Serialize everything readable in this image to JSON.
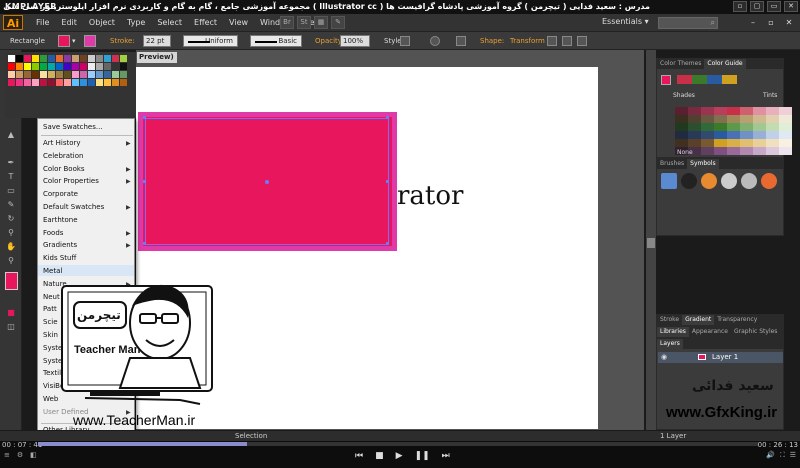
{
  "player": {
    "logo": "KMPLAYER",
    "title": "مجموعه آموزشی جامع ، گام به گام و کاربردی نرم افزار ایلوستریتور سی سی ( Illustrator cc )  مدرس : سعید فدایی ( تیچرمن ) گروه آموزشی پادشاه گرافیست ها",
    "time_elapsed": "00 : 07 : 41",
    "time_total": "00 : 26 : 13",
    "progress_fraction": 0.29,
    "win_controls": [
      "▫",
      "▢",
      "▭",
      "✕"
    ]
  },
  "menu": {
    "logo": "Ai",
    "items": [
      "File",
      "Edit",
      "Object",
      "Type",
      "Select",
      "Effect",
      "View",
      "Window",
      "Help"
    ],
    "workspace": "Essentials ▾"
  },
  "control_bar": {
    "tool_name": "Rectangle",
    "stroke_label": "Stroke:",
    "stroke_weight": "22 pt",
    "profile_label": "Uniform",
    "brush_label": "Basic",
    "opacity_label": "Opacity:",
    "opacity_value": "100%",
    "style_label": "Style:",
    "shape_label": "Shape:",
    "transform_label": "Transform",
    "fill_color": "#e8175d",
    "accent_orange": "#e8a030"
  },
  "document": {
    "tab_label": "Preview)",
    "text_fragment": "rator",
    "rect_color": "#e8175d",
    "stroke_color": "#e03aa8"
  },
  "swatch_menu": {
    "top_item": "Save Swatches...",
    "items": [
      {
        "label": "Art History",
        "submenu": true
      },
      {
        "label": "Celebration",
        "submenu": false
      },
      {
        "label": "Color Books",
        "submenu": true
      },
      {
        "label": "Color Properties",
        "submenu": true
      },
      {
        "label": "Corporate",
        "submenu": false
      },
      {
        "label": "Default Swatches",
        "submenu": true
      },
      {
        "label": "Earthtone",
        "submenu": false
      },
      {
        "label": "Foods",
        "submenu": true
      },
      {
        "label": "Gradients",
        "submenu": true
      },
      {
        "label": "Kids Stuff",
        "submenu": false
      },
      {
        "label": "Metal",
        "submenu": false
      },
      {
        "label": "Nature",
        "submenu": true
      },
      {
        "label": "Neut",
        "submenu": false
      },
      {
        "label": "Patt",
        "submenu": false
      },
      {
        "label": "Scie",
        "submenu": false
      },
      {
        "label": "Skin",
        "submenu": false
      },
      {
        "label": "Syste",
        "submenu": false
      },
      {
        "label": "Syste",
        "submenu": false
      },
      {
        "label": "Textil",
        "submenu": false
      },
      {
        "label": "VisiBone2",
        "submenu": false
      },
      {
        "label": "Web",
        "submenu": false
      },
      {
        "label": "User Defined",
        "submenu": true
      }
    ],
    "bottom_item": "Other Library...",
    "highlighted": "Metal"
  },
  "right_panels": {
    "color_tabs": [
      "Color Themes",
      "Color Guide"
    ],
    "shades": "Shades",
    "tints": "Tints",
    "none_label": "None",
    "brush_tabs": [
      "Brushes",
      "Symbols"
    ],
    "stroke_tabs": [
      "Stroke",
      "Gradient",
      "Transparency"
    ],
    "lib_tabs": [
      "Libraries",
      "Appearance",
      "Graphic Styles"
    ],
    "layers_tab": "Layers",
    "layer_name": "Layer 1",
    "layer_count": "1 Layer"
  },
  "status": {
    "tool": "Selection"
  },
  "watermarks": {
    "teacher_logo": "تیچرمن",
    "teacher_en": "Teacher Man",
    "site": "www.TeacherMan.ir",
    "signature": "سعید فدائی",
    "gfx_site": "www.GfxKing.ir"
  }
}
